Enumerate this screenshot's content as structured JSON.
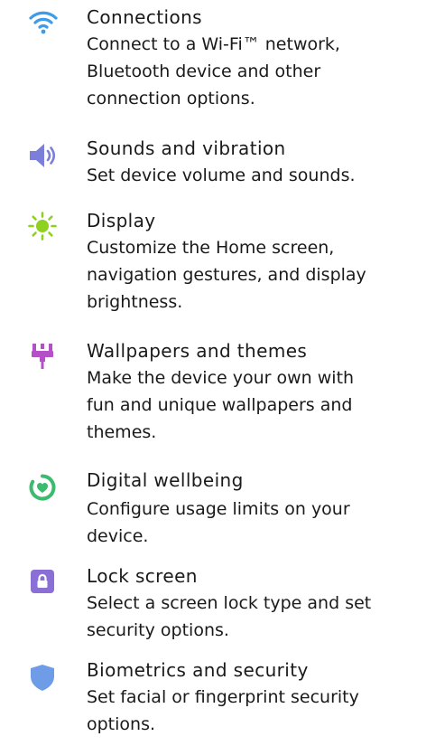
{
  "items": [
    {
      "title": "Connections",
      "icon": "wifi-icon",
      "color": "#3d9be9",
      "lines": [
        "Connect to a Wi-Fi™ network,",
        "Bluetooth device and other",
        "connection options."
      ]
    },
    {
      "title": "Sounds and vibration",
      "icon": "speaker-icon",
      "color": "#7b7fd9",
      "lines": [
        "Set device volume and sounds."
      ]
    },
    {
      "title": "Display",
      "icon": "sun-icon",
      "color": "#8ed11f",
      "lines": [
        "Customize the Home screen,",
        "navigation gestures, and display",
        "brightness."
      ]
    },
    {
      "title": "Wallpapers and themes",
      "icon": "paintbrush-icon",
      "color": "#b44fc8",
      "lines": [
        "Make the device your own with",
        "fun and unique wallpapers and",
        "themes."
      ]
    },
    {
      "title": "Digital wellbeing",
      "icon": "heart-ring-icon",
      "color": "#3bbb6e",
      "lines": [
        "Configure usage limits on your",
        "device."
      ]
    },
    {
      "title": "Lock screen",
      "icon": "lock-icon",
      "color": "#8a6fd6",
      "lines": [
        "Select a screen lock type and set",
        "security options."
      ]
    },
    {
      "title": "Biometrics and security",
      "icon": "shield-icon",
      "color": "#6f9ce6",
      "lines": [
        "Set facial or fingerprint security",
        "options."
      ]
    }
  ]
}
